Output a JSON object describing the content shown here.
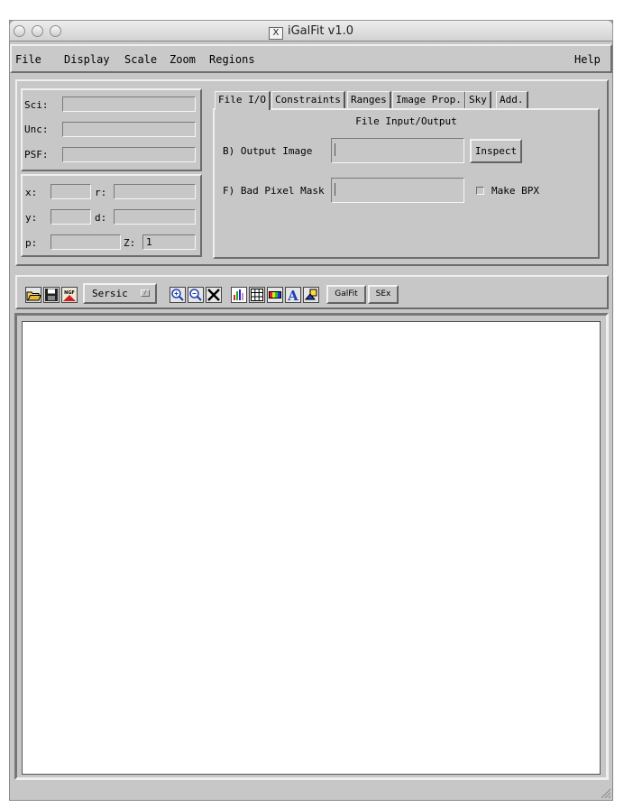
{
  "window": {
    "title": "iGalFit v1.0",
    "x_logo": "X"
  },
  "menu": {
    "items": [
      "File",
      "Display",
      "Scale",
      "Zoom",
      "Regions"
    ],
    "help": "Help"
  },
  "info": {
    "sci_label": "Sci:",
    "unc_label": "Unc:",
    "psf_label": "PSF:",
    "x_label": "x:",
    "r_label": "r:",
    "y_label": "y:",
    "d_label": "d:",
    "p_label": "p:",
    "z_label": "Z:",
    "z_value": "1"
  },
  "tabs": {
    "items": [
      "File I/O",
      "Constraints",
      "Ranges",
      "Image Prop.",
      "Sky",
      "Add."
    ],
    "active": "File I/O"
  },
  "file_io": {
    "heading": "File Input/Output",
    "output_label": "B) Output Image",
    "output_value": "",
    "inspect": "Inspect",
    "mask_label": "F) Bad Pixel Mask",
    "mask_value": "",
    "make_bpx": "Make BPX"
  },
  "toolbar": {
    "model": "Sersic",
    "galfit": "GalFit",
    "sex": "SEx",
    "icons": [
      "open-folder-icon",
      "save-icon",
      "ngf-icon",
      "zoom-in-icon",
      "zoom-out-icon",
      "close-icon",
      "histogram-icon",
      "table-icon",
      "colorbar-icon",
      "text-icon",
      "region-icon"
    ]
  }
}
